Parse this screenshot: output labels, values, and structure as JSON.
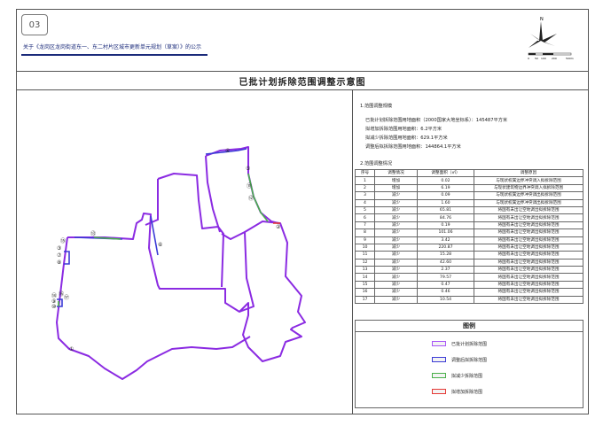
{
  "page_number": "03",
  "header_title": "关于《龙岗区龙岗街道东一、东二村片区城市更新单元规划（草案）》的公示",
  "north_label": "N",
  "scale_labels": [
    "0",
    "50",
    "100",
    "200",
    "500m"
  ],
  "main_title": "已批计划拆除范围调整示意图",
  "section1": {
    "title": "1.范围调整规模",
    "lines": [
      "已批计划拆除范围用地面积（2000国家大地坐标系）：145487平方米",
      "拟增加拆除范围用地面积：6.2平方米",
      "拟减少拆除范围用地面积：629.1平方米",
      "调整后拟拆除范围用地面积：144864.1平方米"
    ]
  },
  "section2": {
    "title": "2.范围调整情况",
    "headers": [
      "序号",
      "调整情况",
      "调整面积（㎡）",
      "调整原因"
    ],
    "rows": [
      [
        "1",
        "增加",
        "0.02",
        "与现状权属边界冲突调入拟拆除范围"
      ],
      [
        "2",
        "增加",
        "6.19",
        "与现状建筑物边界冲突调入拟拆除范围"
      ],
      [
        "3",
        "减少",
        "0.09",
        "与现状权属边界冲突调出拟拆除范围"
      ],
      [
        "4",
        "减少",
        "1.60",
        "与现状权属边界冲突调出拟拆除范围"
      ],
      [
        "5",
        "减少",
        "65.81",
        "将国有未出让空地调出拟拆除范围"
      ],
      [
        "6",
        "减少",
        "84.76",
        "将国有未出让空地调出拟拆除范围"
      ],
      [
        "7",
        "减少",
        "0.19",
        "将国有未出让空地调出拟拆除范围"
      ],
      [
        "8",
        "减少",
        "101.06",
        "将国有未出让空地调出拟拆除范围"
      ],
      [
        "9",
        "减少",
        "3.42",
        "将国有未出让空地调出拟拆除范围"
      ],
      [
        "10",
        "减少",
        "220.87",
        "将国有未出让空地调出拟拆除范围"
      ],
      [
        "11",
        "减少",
        "15.28",
        "将国有未出让空地调出拟拆除范围"
      ],
      [
        "12",
        "减少",
        "42.60",
        "将国有未出让空地调出拟拆除范围"
      ],
      [
        "13",
        "减少",
        "2.37",
        "将国有未出让空地调出拟拆除范围"
      ],
      [
        "14",
        "减少",
        "79.57",
        "将国有未出让空地调出拟拆除范围"
      ],
      [
        "15",
        "减少",
        "0.47",
        "将国有未出让空地调出拟拆除范围"
      ],
      [
        "16",
        "减少",
        "0.46",
        "将国有未出让空地调出拟拆除范围"
      ],
      [
        "17",
        "减少",
        "10.54",
        "将国有未出让空地调出拟拆除范围"
      ]
    ]
  },
  "legend": {
    "title": "图例",
    "items": [
      {
        "label": "已批计划拆除范围",
        "color": "#a855f7"
      },
      {
        "label": "调整后拟拆除范围",
        "color": "#3b3bd6"
      },
      {
        "label": "拟减少拆除范围",
        "color": "#49b04a"
      },
      {
        "label": "拟增加拆除范围",
        "color": "#e53935"
      }
    ]
  },
  "map_labels": [
    "①",
    "②",
    "③",
    "④",
    "⑤",
    "⑥",
    "⑦",
    "⑧",
    "⑨",
    "⑩",
    "⑪",
    "⑫",
    "⑬",
    "⑭",
    "⑮",
    "⑯",
    "⑰"
  ],
  "colors": {
    "approved": "#8b2be2",
    "adjusted": "#3b3bd6",
    "reduce": "#49b04a",
    "increase": "#e53935",
    "header_text": "#1a2a7a"
  }
}
